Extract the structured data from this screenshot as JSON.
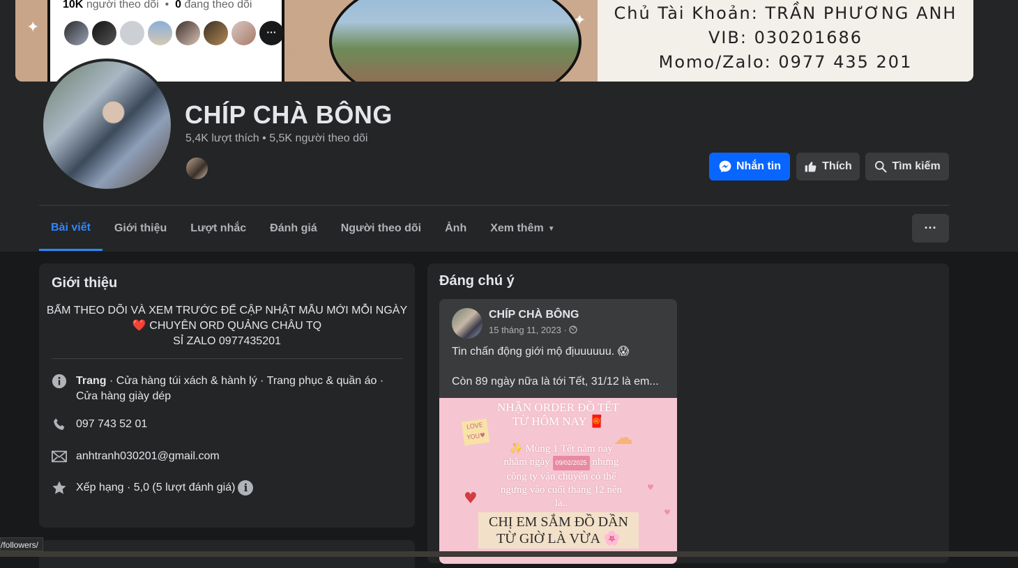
{
  "cover": {
    "card_followers_count": "10K",
    "card_followers_label": "người theo dõi",
    "card_following_count": "0",
    "card_following_label": "đang theo dõi",
    "card_more": "···",
    "owner_line": "Chủ Tài Khoản: TRẦN PHƯƠNG ANH",
    "bank_line": "VIB: 030201686",
    "momo_line": "Momo/Zalo: 0977 435 201"
  },
  "page": {
    "name": "CHÍP CHÀ BÔNG",
    "stats": "5,4K lượt thích • 5,5K người theo dõi"
  },
  "actions": {
    "message": "Nhắn tin",
    "like": "Thích",
    "search": "Tìm kiếm",
    "more": "···"
  },
  "tabs": [
    {
      "label": "Bài viết",
      "active": true
    },
    {
      "label": "Giới thiệu"
    },
    {
      "label": "Lượt nhắc"
    },
    {
      "label": "Đánh giá"
    },
    {
      "label": "Người theo dõi"
    },
    {
      "label": "Ảnh"
    },
    {
      "label": "Xem thêm"
    }
  ],
  "intro": {
    "title": "Giới thiệu",
    "bio_line1": "BẤM THEO DÕI VÀ XEM TRƯỚC ĐỂ CẬP NHẬT MẪU MỚI MỖI NGÀY",
    "bio_heart": "❤️",
    "bio_line2": "CHUYÊN ORD QUẢNG CHÂU TQ",
    "bio_line3": "SỈ ZALO 0977435201",
    "category_label": "Trang",
    "category_text": " · Cửa hàng túi xách & hành lý · Trang phục & quần áo · Cửa hàng giày dép",
    "phone": "097 743 52 01",
    "email": "anhtranh030201@gmail.com",
    "rating": "Xếp hạng · 5,0 (5 lượt đánh giá)"
  },
  "featured": {
    "title": "Đáng chú ý",
    "post": {
      "author": "CHÍP CHÀ BÔNG",
      "date": "15 tháng 11, 2023 ·",
      "text1": "Tin chấn động giới mộ địuuuuuu. 😱",
      "text2": "Còn 89 ngày nữa là tới Tết, 31/12 là em...",
      "image": {
        "heading1": "NHẬN ORDER ĐỒ TẾT",
        "heading2": "TỪ HÔM NAY 🧧",
        "body1": "✨ Mùng 1 Tết năm nay",
        "body2a": "nhằm ngày",
        "body_date": "09/02/2025",
        "body2b": "nhưng",
        "body3": "công ty vận chuyển có thể",
        "body4": "ngưng vào cuối tháng 12 nên",
        "body5": "là..",
        "bottom1": "CHỊ EM SẮM ĐỒ DẦN",
        "bottom2": "TỪ GIỜ LÀ VỪA 🌸"
      }
    }
  },
  "status_url": "/followers/"
}
